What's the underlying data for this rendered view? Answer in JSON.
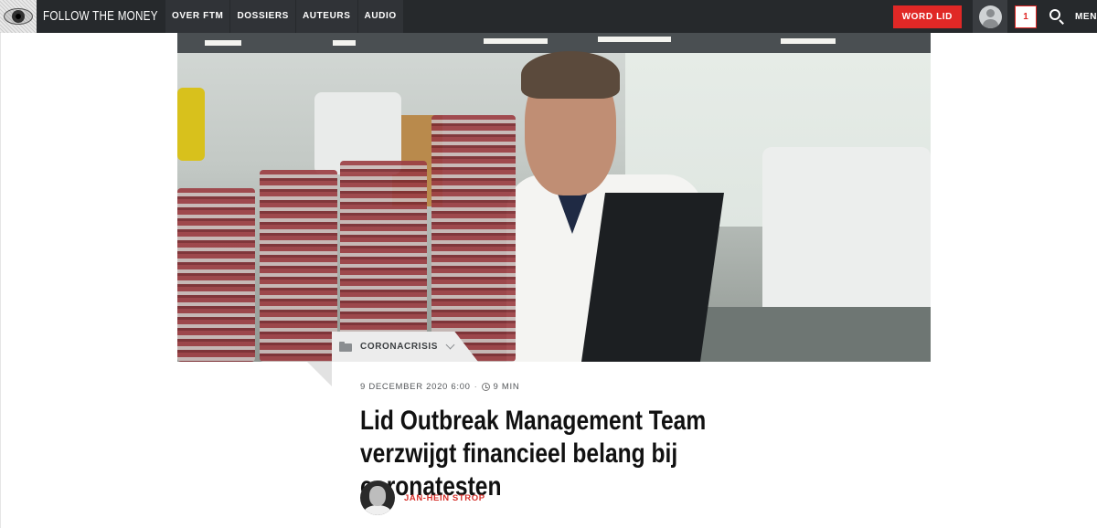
{
  "brand": {
    "name": "FOLLOW THE MONEY",
    "logo_icon": "eye-icon"
  },
  "nav": {
    "items": [
      {
        "label": "OVER FTM"
      },
      {
        "label": "DOSSIERS"
      },
      {
        "label": "AUTEURS"
      },
      {
        "label": "AUDIO"
      }
    ],
    "cta_label": "WORD LID",
    "notifications_count": "1",
    "menu_label": "MENU"
  },
  "colors": {
    "accent": "#e02826",
    "nav_bg": "#26292c"
  },
  "article": {
    "category": "CORONACRISIS",
    "date": "9 DECEMBER 2020 6:00",
    "separator": "·",
    "read_time": "9 MIN",
    "title": "Lid Outbreak Management Team verzwijgt financieel belang bij coronatesten",
    "author": "JAN-HEIN STROP"
  }
}
